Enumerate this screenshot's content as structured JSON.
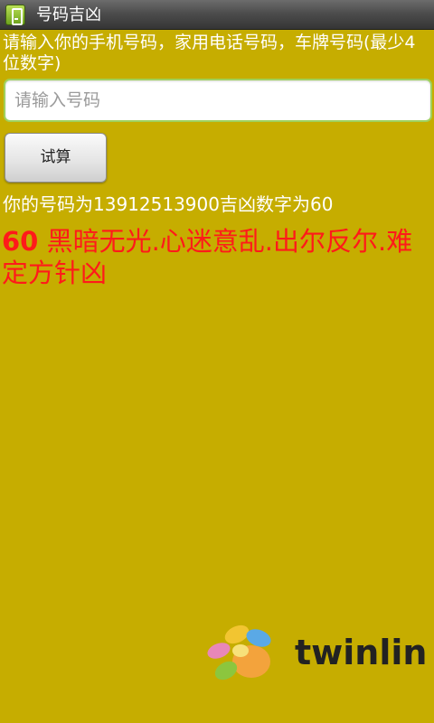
{
  "app": {
    "title": "号码吉凶"
  },
  "form": {
    "prompt": "请输入你的手机号码，家用电话号码，车牌号码(最少4位数字)",
    "input_placeholder": "请输入号码",
    "input_value": "",
    "button_label": "试算"
  },
  "result": {
    "summary": "你的号码为13912513900吉凶数字为60",
    "number": "60",
    "description": "黑暗无光.心迷意乱.出尔反尔.难定方针凶"
  },
  "branding": {
    "logo_text": "twinlin"
  },
  "colors": {
    "background": "#c6ad00",
    "verdict": "#ff1a1a",
    "input_border": "#9fd15c"
  }
}
